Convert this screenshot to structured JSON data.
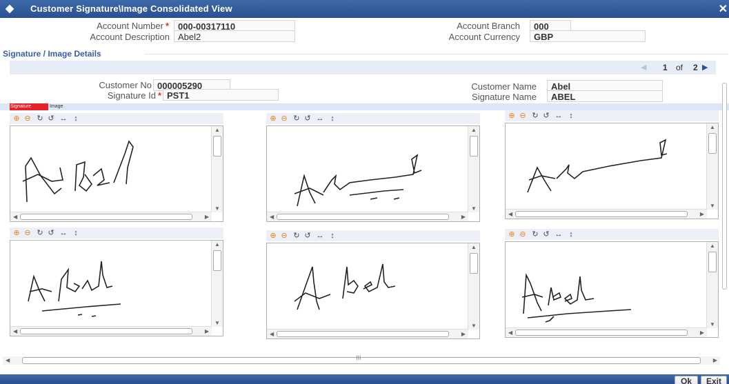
{
  "window": {
    "title": "Customer Signature\\Image Consolidated View",
    "close_glyph": "✕"
  },
  "account": {
    "number_label": "Account Number",
    "number_value": "000-00317110",
    "branch_label": "Account Branch",
    "branch_value": "000",
    "description_label": "Account Description",
    "description_value": "Abel2",
    "currency_label": "Account Currency",
    "currency_value": "GBP"
  },
  "section": {
    "title": "Signature / Image Details"
  },
  "pager": {
    "current": "1",
    "of_label": "of",
    "total": "2"
  },
  "customer": {
    "no_label": "Customer No",
    "no_value": "000005290",
    "name_label": "Customer Name",
    "name_value": "Abel",
    "sig_id_label": "Signature Id",
    "sig_id_value": "PST1",
    "sig_name_label": "Signature Name",
    "sig_name_value": "ABEL"
  },
  "tabs": {
    "signature": "Signature",
    "image": "Image"
  },
  "tool_icons": [
    "zoom-in-icon",
    "zoom-out-icon",
    "rotate-right-icon",
    "rotate-left-icon",
    "flip-horizontal-icon",
    "flip-vertical-icon"
  ],
  "scroll_grip": "III",
  "footer": {
    "ok_label": "Ok",
    "exit_label": "Exit"
  },
  "colors": {
    "title_bar": "#2a5090",
    "required": "#e0302c",
    "active_tab": "#e8202a",
    "section_title": "#3a5da8"
  }
}
